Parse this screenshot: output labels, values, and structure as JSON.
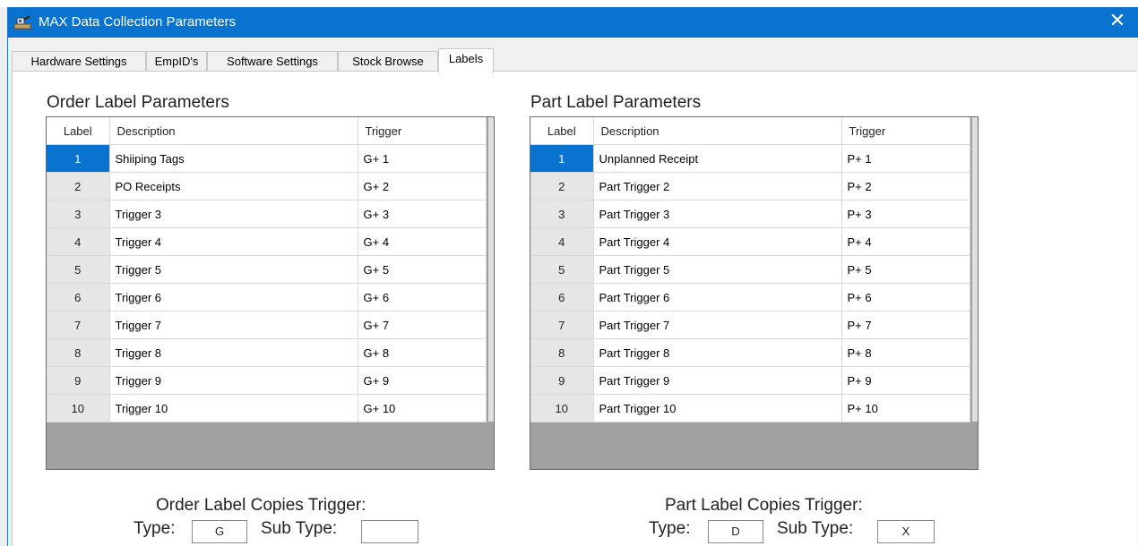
{
  "window": {
    "title": "MAX Data Collection Parameters",
    "close_glyph": "✕"
  },
  "tabs": [
    {
      "label": "Hardware Settings"
    },
    {
      "label": "EmpID's"
    },
    {
      "label": "Software Settings"
    },
    {
      "label": "Stock Browse"
    },
    {
      "label": "Labels",
      "active": true
    }
  ],
  "order_labels": {
    "title": "Order Label Parameters",
    "headers": {
      "label": "Label",
      "description": "Description",
      "trigger": "Trigger"
    },
    "rows": [
      {
        "label": "1",
        "description": "Shiiping Tags",
        "trigger": "G+ 1",
        "selected": true
      },
      {
        "label": "2",
        "description": "PO Receipts",
        "trigger": "G+ 2"
      },
      {
        "label": "3",
        "description": "Trigger 3",
        "trigger": "G+ 3"
      },
      {
        "label": "4",
        "description": "Trigger 4",
        "trigger": "G+ 4"
      },
      {
        "label": "5",
        "description": "Trigger 5",
        "trigger": "G+ 5"
      },
      {
        "label": "6",
        "description": "Trigger 6",
        "trigger": "G+ 6"
      },
      {
        "label": "7",
        "description": "Trigger 7",
        "trigger": "G+ 7"
      },
      {
        "label": "8",
        "description": "Trigger 8",
        "trigger": "G+ 8"
      },
      {
        "label": "9",
        "description": "Trigger 9",
        "trigger": "G+ 9"
      },
      {
        "label": "10",
        "description": "Trigger 10",
        "trigger": "G+ 10"
      }
    ],
    "copies": {
      "title": "Order Label Copies Trigger:",
      "type_label": "Type:",
      "type_value": "G",
      "subtype_label": "Sub Type:",
      "subtype_value": ""
    }
  },
  "part_labels": {
    "title": "Part Label Parameters",
    "headers": {
      "label": "Label",
      "description": "Description",
      "trigger": "Trigger"
    },
    "rows": [
      {
        "label": "1",
        "description": "Unplanned Receipt",
        "trigger": "P+ 1",
        "selected": true
      },
      {
        "label": "2",
        "description": "Part Trigger 2",
        "trigger": "P+ 2"
      },
      {
        "label": "3",
        "description": "Part Trigger 3",
        "trigger": "P+ 3"
      },
      {
        "label": "4",
        "description": "Part Trigger 4",
        "trigger": "P+ 4"
      },
      {
        "label": "5",
        "description": "Part Trigger 5",
        "trigger": "P+ 5"
      },
      {
        "label": "6",
        "description": "Part Trigger 6",
        "trigger": "P+ 6"
      },
      {
        "label": "7",
        "description": "Part Trigger 7",
        "trigger": "P+ 7"
      },
      {
        "label": "8",
        "description": "Part Trigger 8",
        "trigger": "P+ 8"
      },
      {
        "label": "9",
        "description": "Part Trigger 9",
        "trigger": "P+ 9"
      },
      {
        "label": "10",
        "description": "Part Trigger 10",
        "trigger": "P+ 10"
      }
    ],
    "copies": {
      "title": "Part Label Copies Trigger:",
      "type_label": "Type:",
      "type_value": "D",
      "subtype_label": "Sub Type:",
      "subtype_value": "X"
    }
  },
  "colors": {
    "titlebar": "#0a73d0",
    "selected_row": "#0a73d0",
    "grid_empty": "#a0a0a0"
  }
}
